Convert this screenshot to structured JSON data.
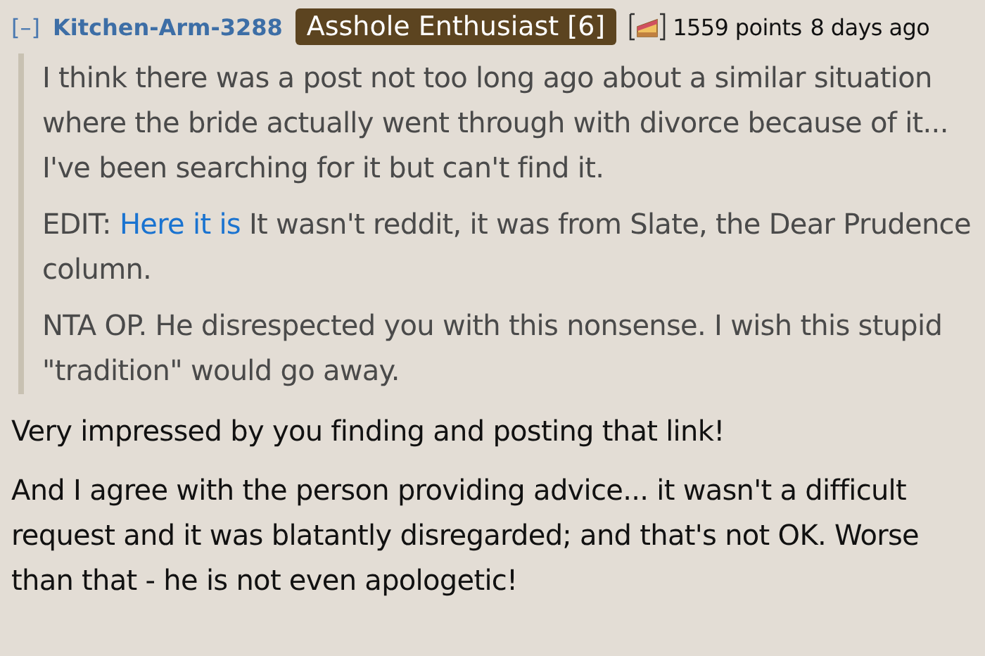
{
  "comment": {
    "toggle": "[–]",
    "author": "Kitchen-Arm-3288",
    "flair": "Asshole Enthusiast [6]",
    "cake_day": true,
    "points": "1559 points",
    "age": "8 days ago"
  },
  "quote": [
    {
      "kind": "text",
      "text": "I think there was a post not too long ago about a similar situation where the bride actually went through with divorce because of it... I've been searching for it but can't find it."
    },
    {
      "kind": "link",
      "prefix": "EDIT:",
      "link": "Here it is",
      "text": "It wasn't reddit, it was from Slate, the Dear Prudence column."
    },
    {
      "kind": "text",
      "text": "NTA OP. He disrespected you with this nonsense. I wish this stupid \"tradition\" would go away."
    }
  ],
  "body": [
    "Very impressed by you finding and posting that link!",
    "And I agree with the person providing advice... it wasn't a difficult request and it was blatantly disregarded; and that's not OK. Worse than that - he is not even apologetic!"
  ]
}
